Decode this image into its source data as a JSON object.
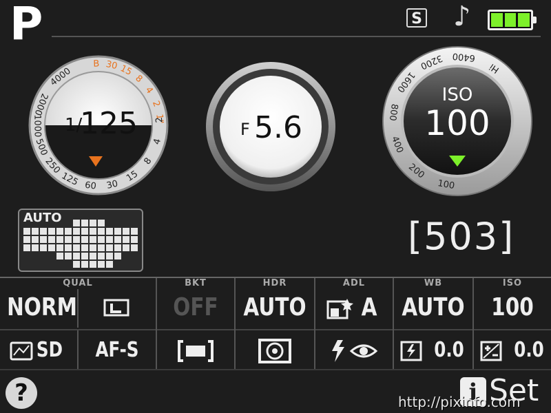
{
  "header": {
    "mode": "P",
    "badge": "S",
    "note_icon": "music-note-icon",
    "battery_level": 1.0,
    "battery_color": "#7df02a"
  },
  "shutter_dial": {
    "prefix": "1/",
    "value": "125",
    "scale_top": [
      "B",
      "30",
      "15",
      "8",
      "4",
      "2",
      "1\""
    ],
    "scale_bottom": [
      "2000",
      "1000",
      "500",
      "250",
      "125",
      "60",
      "30",
      "15",
      "8",
      "4",
      "2"
    ],
    "scale_topleft": [
      "4000"
    ],
    "indicator_color": "#e8731e"
  },
  "aperture_dial": {
    "prefix": "F",
    "value": "5.6"
  },
  "iso_dial": {
    "label": "ISO",
    "value": "100",
    "scale": [
      "Hi",
      "6400",
      "3200",
      "1600",
      "800",
      "400",
      "200",
      "100"
    ],
    "indicator_color": "#7df02a"
  },
  "auto_box": {
    "label": "AUTO"
  },
  "shots_remaining": "[503]",
  "table": {
    "columns": [
      {
        "header": "QUAL",
        "row1": "NORM",
        "row1_icon": "image-size-L-icon",
        "row2": "SD"
      },
      {
        "header": "",
        "row1": "",
        "row2": "AF-S"
      },
      {
        "header": "BKT",
        "row1": "OFF",
        "row2_icon": "af-area-icon"
      },
      {
        "header": "HDR",
        "row1": "AUTO",
        "row2_icon": "metering-icon"
      },
      {
        "header": "ADL",
        "row1": "A",
        "row2_icon": "flash-redeye-icon"
      },
      {
        "header": "WB",
        "row1": "AUTO",
        "row2": "0.0"
      },
      {
        "header": "ISO",
        "row1": "100",
        "row2": "0.0"
      }
    ]
  },
  "footer": {
    "help": "?",
    "info_icon": "i",
    "set_label": "Set",
    "watermark": "http://pixinfo.com"
  }
}
